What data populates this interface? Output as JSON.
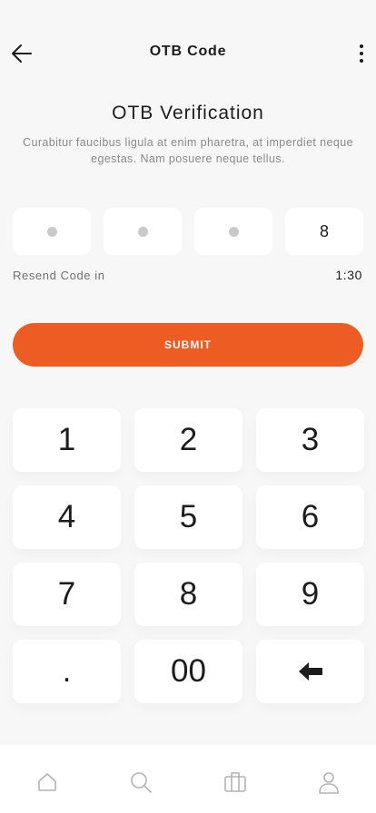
{
  "header": {
    "title": "OTB Code",
    "back_icon": "arrow-left-icon",
    "more_icon": "more-vertical-icon"
  },
  "verification": {
    "title": "OTB Verification",
    "description": "Curabitur faucibus ligula at enim pharetra, at imperdiet neque egestas. Nam posuere neque tellus."
  },
  "code": {
    "digits": [
      "",
      "",
      "",
      "8"
    ]
  },
  "resend": {
    "label": "Resend Code in",
    "timer": "1:30"
  },
  "submit": {
    "label": "SUBMIT"
  },
  "keypad": {
    "keys": [
      "1",
      "2",
      "3",
      "4",
      "5",
      "6",
      "7",
      "8",
      "9",
      ".",
      "00"
    ],
    "backspace_icon": "backspace-arrow-icon"
  },
  "bottom_nav": {
    "items": [
      "home-icon",
      "search-icon",
      "briefcase-icon",
      "profile-icon"
    ]
  },
  "colors": {
    "accent": "#ec5c23",
    "background": "#f7f7f7",
    "surface": "#ffffff",
    "text": "#1c1c1c",
    "muted": "#8a8a8a"
  }
}
